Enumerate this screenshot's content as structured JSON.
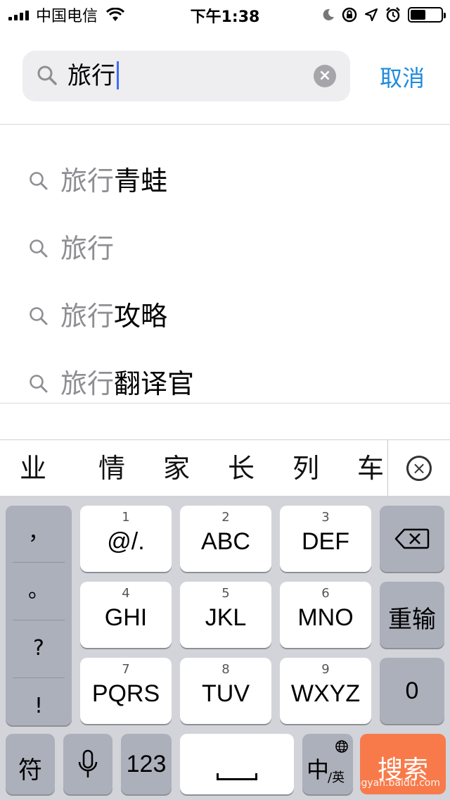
{
  "status_bar": {
    "carrier": "中国电信",
    "time": "下午1:38",
    "battery_level": 0.5
  },
  "search": {
    "query": "旅行",
    "cancel_label": "取消"
  },
  "suggestions": [
    {
      "prefix": "旅行",
      "suffix": "青蛙"
    },
    {
      "prefix": "旅行",
      "suffix": ""
    },
    {
      "prefix": "旅行",
      "suffix": "攻略"
    },
    {
      "prefix": "旅行",
      "suffix": "翻译官"
    }
  ],
  "candidates": [
    "业",
    "情",
    "家",
    "长",
    "列",
    "车"
  ],
  "keyboard": {
    "punctuation": [
      "，",
      "。",
      "?",
      "!"
    ],
    "keys": [
      {
        "num": "1",
        "label": "@/."
      },
      {
        "num": "2",
        "label": "ABC"
      },
      {
        "num": "3",
        "label": "DEF"
      },
      {
        "num": "4",
        "label": "GHI"
      },
      {
        "num": "5",
        "label": "JKL"
      },
      {
        "num": "6",
        "label": "MNO"
      },
      {
        "num": "7",
        "label": "PQRS"
      },
      {
        "num": "8",
        "label": "TUV"
      },
      {
        "num": "9",
        "label": "WXYZ"
      }
    ],
    "reinput_label": "重输",
    "zero_label": "0",
    "symbols_label": "符",
    "numbers_label": "123",
    "lang_primary": "中",
    "lang_secondary": "/英",
    "search_label": "搜索",
    "watermark": "jingyan.baidu.com"
  },
  "colors": {
    "accent": "#1e8bdc",
    "caret": "#3d6ef2",
    "search_key": "#f87a4a"
  }
}
